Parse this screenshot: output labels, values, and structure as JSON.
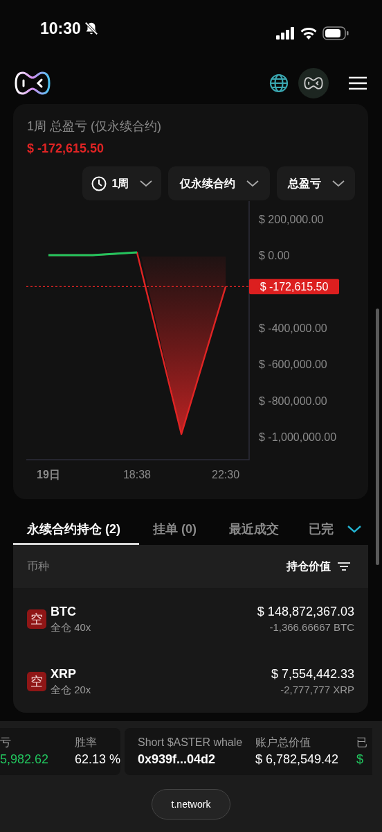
{
  "status_bar": {
    "time": "10:30"
  },
  "pnl_card": {
    "title": "1周 总盈亏 (仅永续合约)",
    "value": "$ -172,615.50",
    "filters": [
      {
        "kind": "period",
        "label": "1周"
      },
      {
        "kind": "option",
        "label": "仅永续合约"
      },
      {
        "kind": "option",
        "label": "总盈亏"
      }
    ],
    "chart_data": {
      "type": "line",
      "categories": [
        "19日",
        null,
        "18:38",
        null,
        "22:30"
      ],
      "series": [
        {
          "color": "#e02424",
          "values": [
            0,
            0,
            15000,
            -985000,
            -173000
          ]
        },
        {
          "color": "#22c55e",
          "values": [
            0,
            0,
            15000,
            null,
            null
          ]
        }
      ],
      "ylim": [
        -1126000,
        297700
      ],
      "yticks": [
        {
          "value": 200000,
          "label": "$ 200,000.00"
        },
        {
          "value": 0,
          "label": "$ 0.00"
        },
        {
          "value": -400000,
          "label": "$ -400,000.00"
        },
        {
          "value": -600000,
          "label": "$ -600,000.00"
        },
        {
          "value": -800000,
          "label": "$ -800,000.00"
        },
        {
          "value": -1000000,
          "label": "$ -1,000,000.00"
        }
      ]
    },
    "current_label": "$ -172,615.50"
  },
  "tabs": [
    {
      "label": "永续合约持仓 (2)",
      "selected": true
    },
    {
      "label": "挂单 (0)",
      "selected": false
    },
    {
      "label": "最近成交",
      "selected": false
    },
    {
      "label": "已完",
      "selected": false
    }
  ],
  "positions_table": {
    "columns": [
      {
        "label": "币种"
      },
      {
        "label": "持仓价值"
      }
    ],
    "rows": [
      {
        "badge": "空",
        "symbol": "BTC",
        "margin": "全仓 40x",
        "value": "$ 148,872,367.03",
        "size": "-1,366.66667 BTC"
      },
      {
        "badge": "空",
        "symbol": "XRP",
        "margin": "全仓 20x",
        "value": "$ 7,554,442.33",
        "size": "-2,777,777 XRP"
      }
    ]
  },
  "ticker_cards": [
    {
      "items": [
        {
          "kind": "stat",
          "label": "亏",
          "value": "5,982.62",
          "color": "#22c55e"
        },
        {
          "kind": "stat",
          "label": "胜率",
          "value": "62.13 %",
          "color": "#ffffff"
        }
      ]
    },
    {
      "items": [
        {
          "kind": "address",
          "label": "Short $ASTER whale",
          "value": "0x939f...04d2",
          "color": "#ffffff"
        },
        {
          "kind": "stat",
          "label": "账户总价值",
          "value": "$ 6,782,549.42",
          "color": "#ffffff"
        },
        {
          "kind": "stat",
          "label": "已",
          "value": "$",
          "color": "#22c55e"
        }
      ]
    }
  ],
  "bottom_pill": {
    "text": "t.network"
  }
}
